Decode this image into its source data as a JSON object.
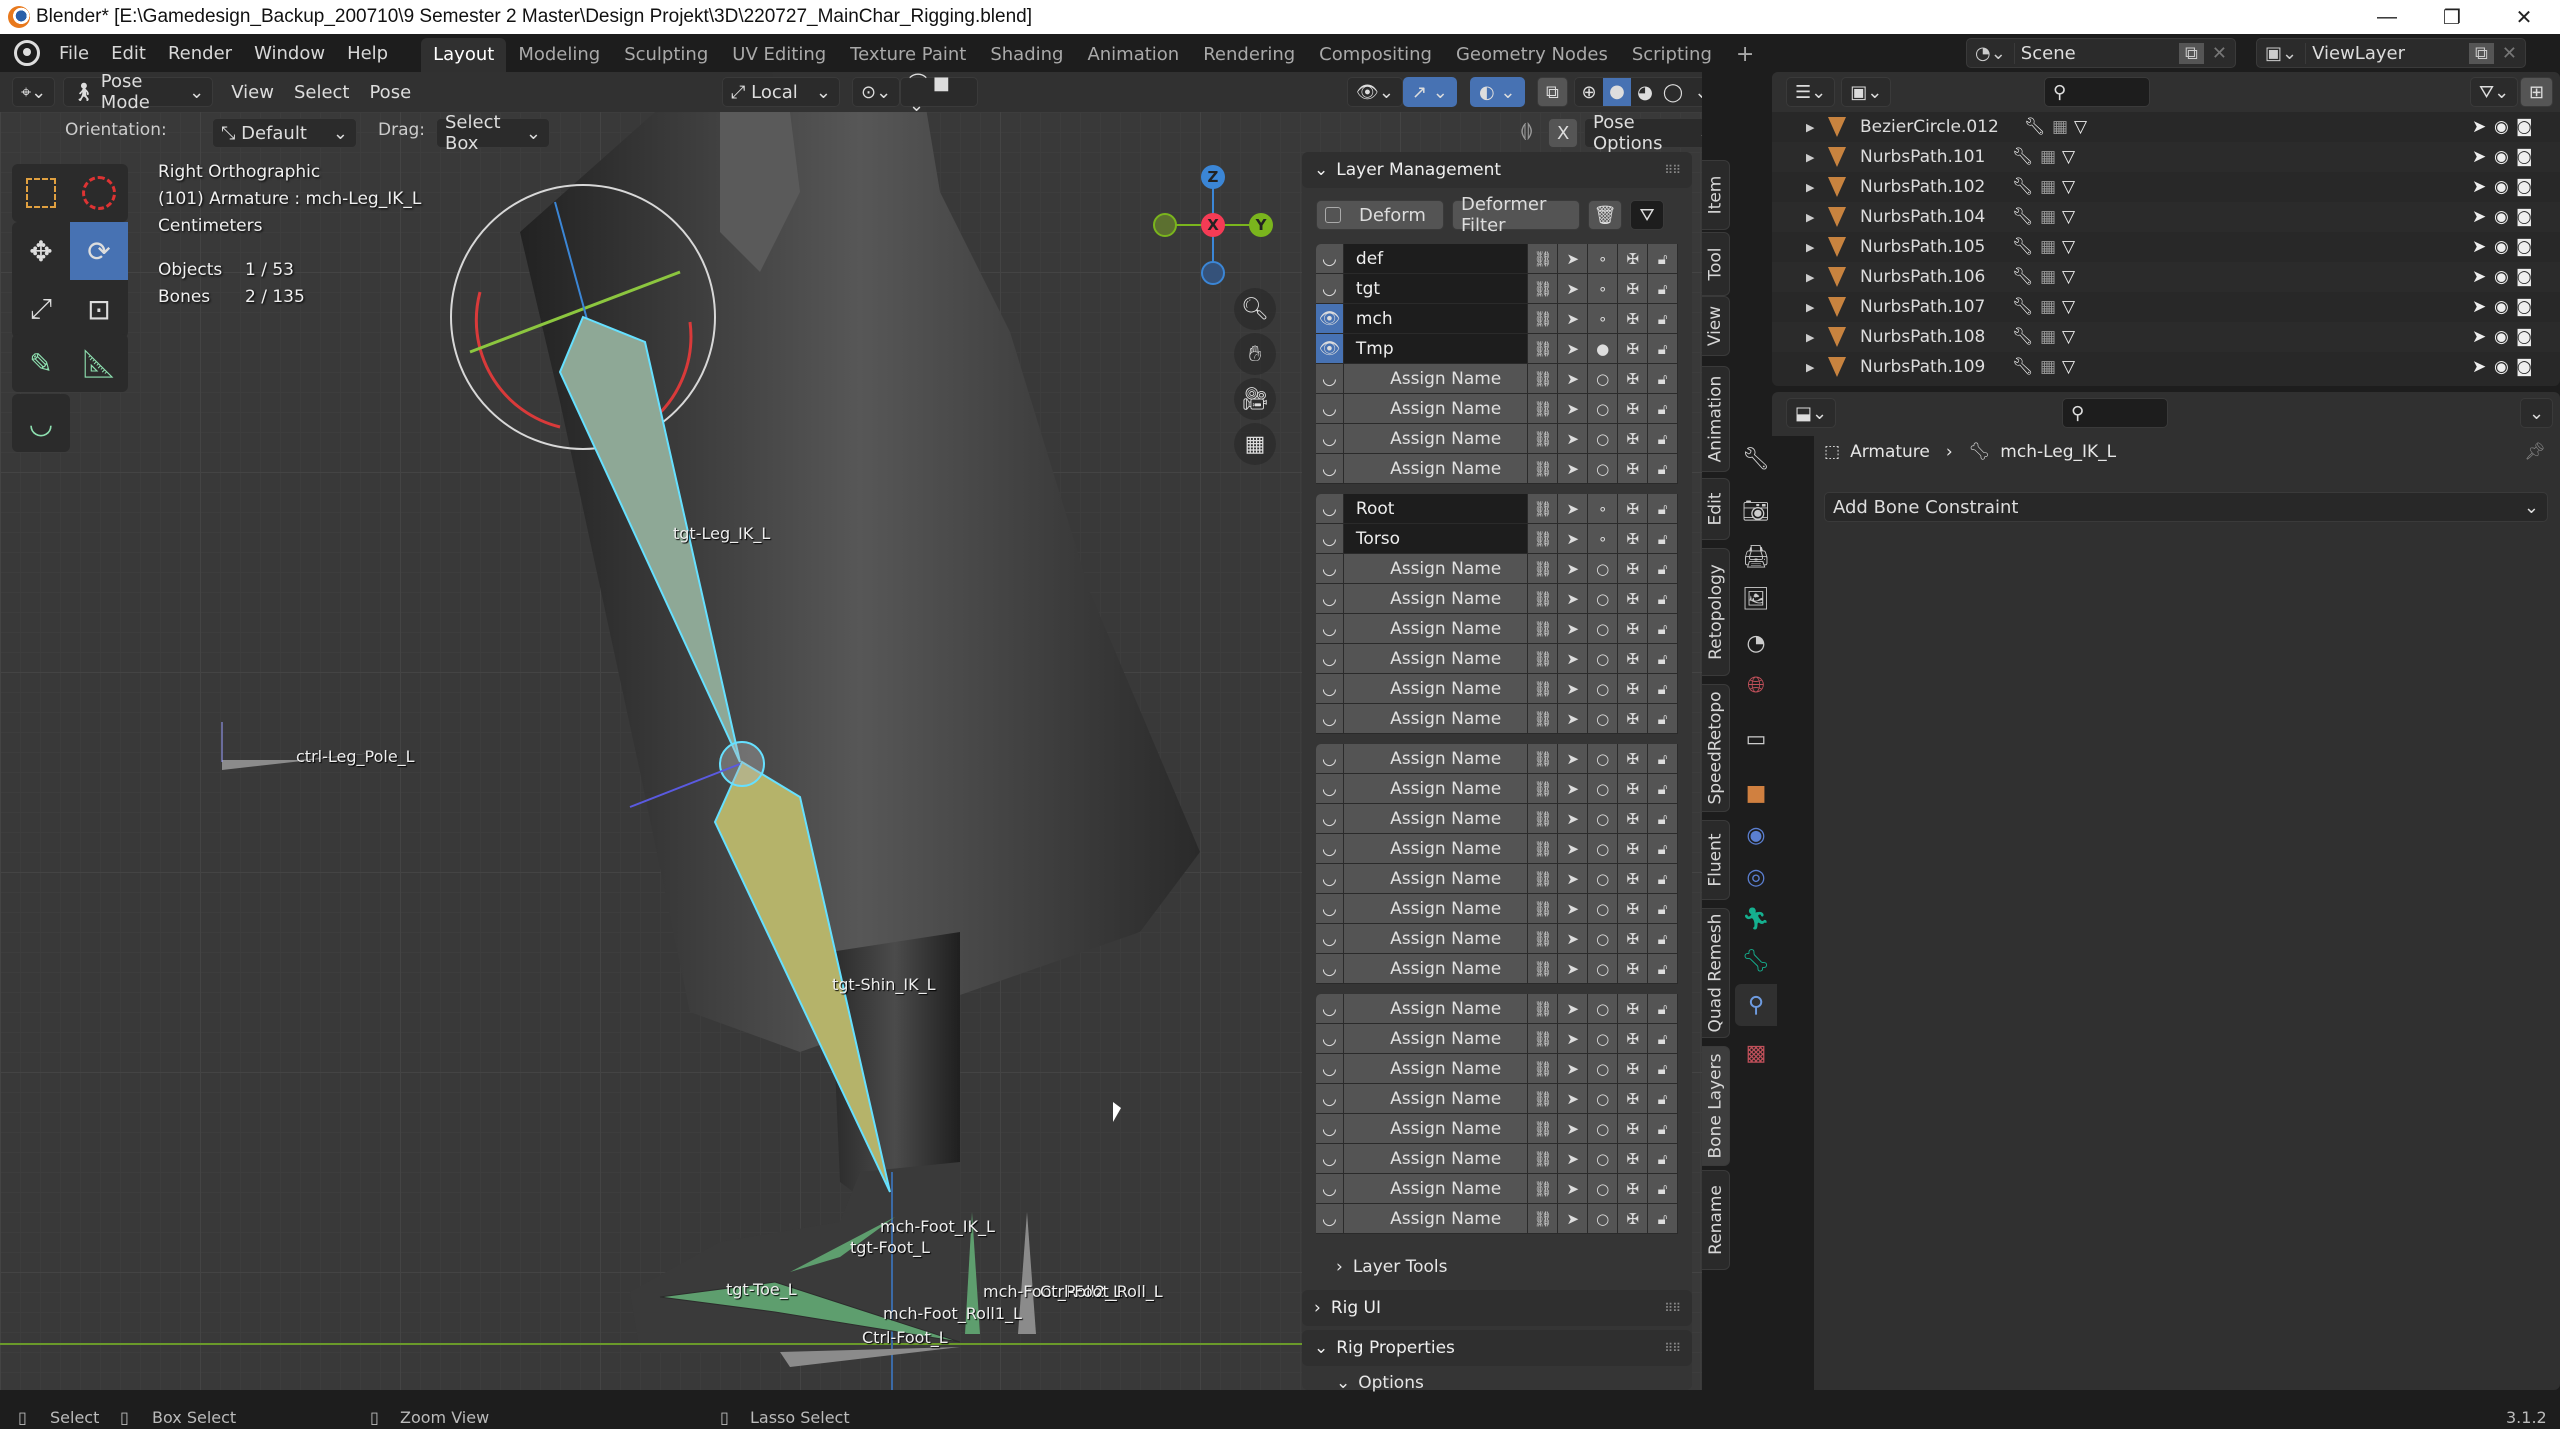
{
  "window": {
    "title": "Blender* [E:\\Gamedesign_Backup_200710\\9 Semester 2 Master\\Design Projekt\\3D\\220727_MainChar_Rigging.blend]",
    "controls": {
      "minimize": "—",
      "maximize": "❐",
      "close": "✕"
    }
  },
  "menu": {
    "items": [
      "File",
      "Edit",
      "Render",
      "Window",
      "Help"
    ],
    "workspaces": [
      "Layout",
      "Modeling",
      "Sculpting",
      "UV Editing",
      "Texture Paint",
      "Shading",
      "Animation",
      "Rendering",
      "Compositing",
      "Geometry Nodes",
      "Scripting"
    ],
    "active_workspace": "Layout",
    "add_workspace": "+"
  },
  "scene": {
    "scene_name": "Scene",
    "view_layer": "ViewLayer"
  },
  "viewport_header": {
    "mode": "Pose Mode",
    "menus": [
      "View",
      "Select",
      "Pose"
    ],
    "transform_orientation": "Local",
    "pose_options": "Pose Options",
    "x_mirror": "X",
    "orientation_label": "Orientation:",
    "orientation_value": "Default",
    "drag_label": "Drag:",
    "drag_value": "Select Box"
  },
  "viewport_info": {
    "view": "Right Orthographic",
    "object": "(101) Armature : mch-Leg_IK_L",
    "units": "Centimeters",
    "objects_label": "Objects",
    "objects_value": "1 / 53",
    "bones_label": "Bones",
    "bones_value": "2 / 135"
  },
  "gizmo": {
    "z": "Z",
    "x": "X",
    "y": "Y"
  },
  "bone_labels": {
    "leg": "tgt-Leg_IK_L",
    "pole": "ctrl-Leg_Pole_L",
    "shin": "tgt-Shin_IK_L",
    "foot_ik": "mch-Foot_IK_L",
    "tgt_foot": "tgt-Foot_L",
    "toe": "tgt-Toe_L",
    "roll1": "mch-Foot_Roll1_L",
    "roll2": "mch-Foot_Roll2_L",
    "ctrl_roll": "Ctrl-Foot_Roll_L",
    "ctrl_foot": "Ctrl-Foot_L"
  },
  "layer_management": {
    "title": "Layer Management",
    "deform_label": "Deform",
    "deformer_filter": "Deformer Filter",
    "groups": [
      [
        {
          "name": "def",
          "visible": false,
          "named": true,
          "active": false
        },
        {
          "name": "tgt",
          "visible": false,
          "named": true,
          "active": false
        },
        {
          "name": "mch",
          "visible": true,
          "named": true,
          "active": false
        },
        {
          "name": "Tmp",
          "visible": true,
          "named": true,
          "active": true
        },
        {
          "name": "Assign Name",
          "visible": false,
          "named": false
        },
        {
          "name": "Assign Name",
          "visible": false,
          "named": false
        },
        {
          "name": "Assign Name",
          "visible": false,
          "named": false
        },
        {
          "name": "Assign Name",
          "visible": false,
          "named": false
        }
      ],
      [
        {
          "name": "Root",
          "visible": false,
          "named": true,
          "active": false
        },
        {
          "name": "Torso",
          "visible": false,
          "named": true,
          "active": false
        },
        {
          "name": "Assign Name",
          "visible": false,
          "named": false
        },
        {
          "name": "Assign Name",
          "visible": false,
          "named": false
        },
        {
          "name": "Assign Name",
          "visible": false,
          "named": false
        },
        {
          "name": "Assign Name",
          "visible": false,
          "named": false
        },
        {
          "name": "Assign Name",
          "visible": false,
          "named": false
        },
        {
          "name": "Assign Name",
          "visible": false,
          "named": false
        }
      ],
      [
        {
          "name": "Assign Name",
          "visible": false,
          "named": false
        },
        {
          "name": "Assign Name",
          "visible": false,
          "named": false
        },
        {
          "name": "Assign Name",
          "visible": false,
          "named": false
        },
        {
          "name": "Assign Name",
          "visible": false,
          "named": false
        },
        {
          "name": "Assign Name",
          "visible": false,
          "named": false
        },
        {
          "name": "Assign Name",
          "visible": false,
          "named": false
        },
        {
          "name": "Assign Name",
          "visible": false,
          "named": false
        },
        {
          "name": "Assign Name",
          "visible": false,
          "named": false
        }
      ],
      [
        {
          "name": "Assign Name",
          "visible": false,
          "named": false
        },
        {
          "name": "Assign Name",
          "visible": false,
          "named": false
        },
        {
          "name": "Assign Name",
          "visible": false,
          "named": false
        },
        {
          "name": "Assign Name",
          "visible": false,
          "named": false
        },
        {
          "name": "Assign Name",
          "visible": false,
          "named": false
        },
        {
          "name": "Assign Name",
          "visible": false,
          "named": false
        },
        {
          "name": "Assign Name",
          "visible": false,
          "named": false
        },
        {
          "name": "Assign Name",
          "visible": false,
          "named": false
        }
      ]
    ],
    "layer_tools": "Layer Tools",
    "rig_ui": "Rig UI",
    "rig_properties": "Rig Properties",
    "options": "Options"
  },
  "side_tabs": [
    "Item",
    "Tool",
    "View",
    "Animation",
    "Edit",
    "Retopology",
    "SpeedRetopo",
    "Fluent",
    "Quad Remesh",
    "Bone Layers",
    "Rename"
  ],
  "active_side_tab": "Bone Layers",
  "outliner": {
    "rows": [
      "BezierCircle.012",
      "NurbsPath.101",
      "NurbsPath.102",
      "NurbsPath.104",
      "NurbsPath.105",
      "NurbsPath.106",
      "NurbsPath.107",
      "NurbsPath.108",
      "NurbsPath.109"
    ]
  },
  "properties": {
    "breadcrumb_object": "Armature",
    "breadcrumb_bone": "mch-Leg_IK_L",
    "add_constraint": "Add Bone Constraint",
    "tabs": [
      "tool",
      "render",
      "output",
      "view-layer",
      "scene",
      "world",
      "collection",
      "object",
      "modifiers",
      "physics",
      "object-data",
      "bone",
      "bone-constraints",
      "texture"
    ],
    "active_tab": "bone-constraints"
  },
  "status_bar": {
    "select": "Select",
    "box_select": "Box Select",
    "zoom_view": "Zoom View",
    "lasso_select": "Lasso Select",
    "version": "3.1.2"
  },
  "colors": {
    "accent": "#4772b3",
    "x_axis": "#f53b55",
    "y_axis": "#7ab51d",
    "z_axis": "#3b86d6",
    "object_icon": "#c8833f",
    "data_icon": "#15b08f"
  }
}
